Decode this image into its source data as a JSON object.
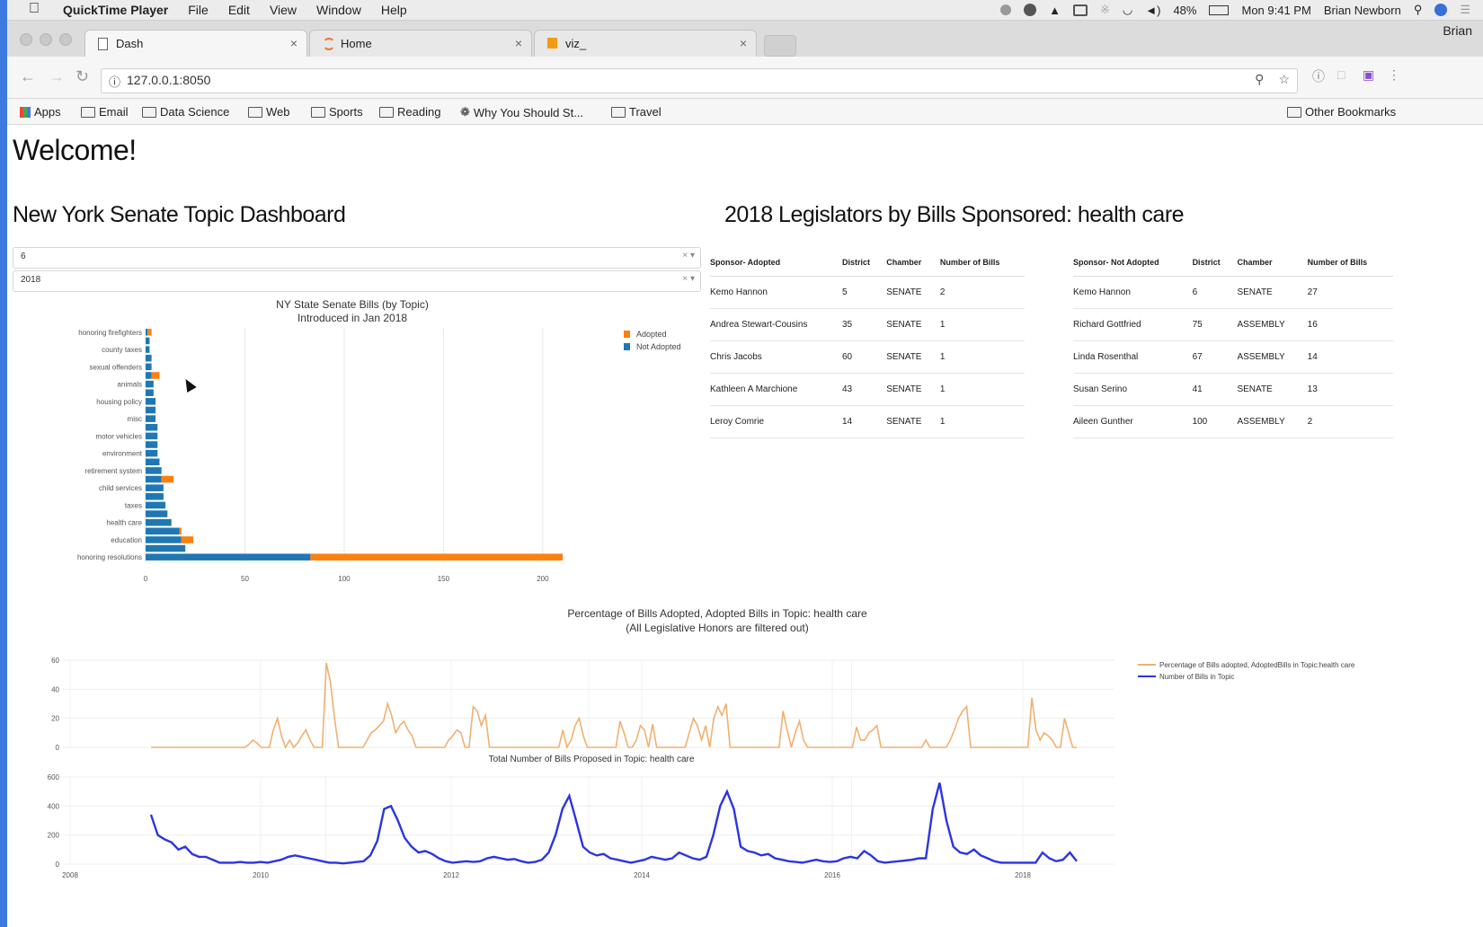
{
  "menubar": {
    "app_name": "QuickTime Player",
    "menus": [
      "File",
      "Edit",
      "View",
      "Window",
      "Help"
    ],
    "battery": "48%",
    "clock": "Mon 9:41 PM",
    "user": "Brian Newborn"
  },
  "browser": {
    "tabs": [
      {
        "label": "Dash",
        "icon": "page-icon"
      },
      {
        "label": "Home",
        "icon": "jupyter-icon"
      },
      {
        "label": "viz_",
        "icon": "notebook-icon"
      }
    ],
    "profile": "Brian",
    "url": "127.0.0.1:8050",
    "bookmarks": [
      "Apps",
      "Email",
      "Data Science",
      "Web",
      "Sports",
      "Reading",
      "Why You Should St...",
      "Travel"
    ],
    "other_bookmarks": "Other Bookmarks"
  },
  "page": {
    "welcome": "Welcome!",
    "dashboard_title": "New York Senate Topic Dashboard",
    "dropdown1_value": "6",
    "dropdown2_value": "2018",
    "legislators_title": "2018 Legislators by Bills Sponsored: health care"
  },
  "adopted_table": {
    "headers": [
      "Sponsor- Adopted",
      "District",
      "Chamber",
      "Number of Bills"
    ],
    "rows": [
      [
        "Kemo Hannon",
        "5",
        "SENATE",
        "2"
      ],
      [
        "Andrea Stewart-Cousins",
        "35",
        "SENATE",
        "1"
      ],
      [
        "Chris Jacobs",
        "60",
        "SENATE",
        "1"
      ],
      [
        "Kathleen A Marchione",
        "43",
        "SENATE",
        "1"
      ],
      [
        "Leroy Comrie",
        "14",
        "SENATE",
        "1"
      ]
    ]
  },
  "not_adopted_table": {
    "headers": [
      "Sponsor- Not Adopted",
      "District",
      "Chamber",
      "Number of Bills"
    ],
    "rows": [
      [
        "Kemo Hannon",
        "6",
        "SENATE",
        "27"
      ],
      [
        "Richard Gottfried",
        "75",
        "ASSEMBLY",
        "16"
      ],
      [
        "Linda Rosenthal",
        "67",
        "ASSEMBLY",
        "14"
      ],
      [
        "Susan Serino",
        "41",
        "SENATE",
        "13"
      ],
      [
        "Aileen Gunther",
        "100",
        "ASSEMBLY",
        "2"
      ]
    ]
  },
  "colors": {
    "adopted": "#ff7f0e",
    "not_adopted": "#1f77b4",
    "percentage_line": "#f0b070",
    "count_line": "#2b35e0"
  },
  "chart_data": [
    {
      "type": "bar",
      "orientation": "horizontal",
      "stacked": true,
      "title": "NY State Senate Bills (by Topic)",
      "subtitle": "Introduced in Jan 2018",
      "categories": [
        "honoring firefighters",
        "county taxes",
        "sexual offenders",
        "animals",
        "housing policy",
        "misc",
        "motor vehicles",
        "environment",
        "retirement system",
        "child services",
        "taxes",
        "health care",
        "education",
        "honoring resolutions"
      ],
      "categories_all": 27,
      "series": [
        {
          "name": "Adopted",
          "values": [
            2,
            0,
            0,
            4,
            0,
            0,
            0,
            0,
            6,
            0,
            0,
            1,
            6,
            127
          ]
        },
        {
          "name": "Not Adopted",
          "values": [
            1,
            2,
            3,
            3,
            4,
            5,
            6,
            6,
            8,
            8,
            9,
            10,
            18,
            83
          ]
        }
      ],
      "series_full": {
        "not_adopted": [
          1,
          2,
          2,
          3,
          3,
          3,
          4,
          4,
          5,
          5,
          5,
          6,
          6,
          6,
          6,
          7,
          8,
          8,
          9,
          9,
          10,
          11,
          13,
          17,
          18,
          20,
          83
        ],
        "adopted": [
          2,
          0,
          0,
          0,
          0,
          4,
          0,
          0,
          0,
          0,
          0,
          0,
          0,
          0,
          0,
          0,
          0,
          6,
          0,
          0,
          0,
          0,
          0,
          1,
          6,
          0,
          127
        ]
      },
      "xlim": [
        0,
        210
      ],
      "xticks": [
        "0",
        "50",
        "100",
        "150",
        "200"
      ],
      "legend": "top-right"
    },
    {
      "type": "line",
      "title": "Percentage of Bills Adopted, Adopted Bills in Topic: health care",
      "subtitle": "(All Legislative Honors are filtered out)",
      "series": [
        {
          "name": "Percentage of Bills adopted, AdoptedBills in Topic:health care",
          "values": [
            0,
            0,
            0,
            0,
            0,
            0,
            0,
            0,
            0,
            0,
            0,
            0,
            0,
            0,
            0,
            0,
            0,
            0,
            0,
            0,
            0,
            0,
            0,
            0,
            2,
            5,
            3,
            0,
            0,
            0,
            12,
            20,
            8,
            0,
            5,
            0,
            3,
            8,
            12,
            5,
            0,
            0,
            0,
            58,
            45,
            20,
            0,
            0,
            0,
            0,
            0,
            0,
            0,
            5,
            10,
            12,
            15,
            18,
            30,
            22,
            10,
            15,
            18,
            12,
            8,
            0,
            0,
            0,
            0,
            0,
            0,
            0,
            0,
            5,
            8,
            12,
            10,
            0,
            0,
            28,
            25,
            15,
            22,
            0,
            0,
            0,
            0,
            0,
            0,
            0,
            0,
            0,
            0,
            0,
            0,
            0,
            0,
            0,
            0,
            0,
            0,
            12,
            0,
            5,
            15,
            20,
            8,
            0,
            0,
            0,
            0,
            0,
            0,
            0,
            0,
            18,
            10,
            0,
            0,
            5,
            15,
            12,
            0,
            16,
            0,
            0,
            0,
            0,
            0,
            0,
            0,
            0,
            10,
            20,
            15,
            5,
            15,
            0,
            20,
            28,
            22,
            30,
            0,
            0,
            0,
            0,
            0,
            0,
            0,
            0,
            0,
            0,
            0,
            0,
            0,
            25,
            12,
            0,
            10,
            18,
            5,
            0,
            0,
            0,
            0,
            0,
            0,
            0,
            0,
            0,
            0,
            0,
            0,
            14,
            5,
            5,
            10,
            12,
            15,
            0,
            0,
            0,
            0,
            0,
            0,
            0,
            0,
            0,
            0,
            0,
            5,
            0,
            0,
            0,
            0,
            0,
            5,
            12,
            20,
            25,
            28,
            0,
            0,
            0,
            0,
            0,
            0,
            0,
            0,
            0,
            0,
            0,
            0,
            0,
            0,
            0,
            34,
            12,
            5,
            10,
            8,
            5,
            0,
            0,
            20,
            10,
            0,
            0
          ]
        }
      ],
      "ylim": [
        0,
        60
      ],
      "yticks": [
        "0",
        "20",
        "40",
        "60"
      ]
    },
    {
      "type": "line",
      "title": "Total Number of Bills Proposed in Topic: health care",
      "series": [
        {
          "name": "Number of Bills in Topic",
          "values": [
            340,
            200,
            170,
            150,
            100,
            120,
            70,
            50,
            50,
            30,
            10,
            10,
            10,
            15,
            10,
            10,
            15,
            10,
            20,
            30,
            50,
            60,
            50,
            40,
            30,
            20,
            10,
            10,
            5,
            10,
            15,
            20,
            60,
            160,
            380,
            400,
            300,
            180,
            120,
            80,
            90,
            70,
            40,
            20,
            10,
            15,
            20,
            15,
            20,
            40,
            50,
            40,
            30,
            35,
            20,
            10,
            15,
            30,
            80,
            200,
            380,
            470,
            300,
            120,
            80,
            60,
            70,
            40,
            30,
            20,
            10,
            20,
            30,
            50,
            40,
            30,
            40,
            80,
            60,
            40,
            30,
            50,
            200,
            400,
            500,
            380,
            120,
            90,
            80,
            60,
            70,
            40,
            30,
            20,
            15,
            10,
            20,
            30,
            20,
            15,
            20,
            40,
            50,
            40,
            90,
            60,
            20,
            10,
            15,
            20,
            25,
            30,
            40,
            40,
            380,
            560,
            300,
            120,
            80,
            70,
            100,
            60,
            40,
            20,
            10,
            10,
            10,
            10,
            10,
            10,
            80,
            40,
            20,
            30,
            80,
            20
          ]
        }
      ],
      "ylim": [
        0,
        600
      ],
      "yticks": [
        "0",
        "200",
        "400",
        "600"
      ],
      "xticks": [
        "2008",
        "2010",
        "2012",
        "2014",
        "2016",
        "2018"
      ]
    }
  ]
}
